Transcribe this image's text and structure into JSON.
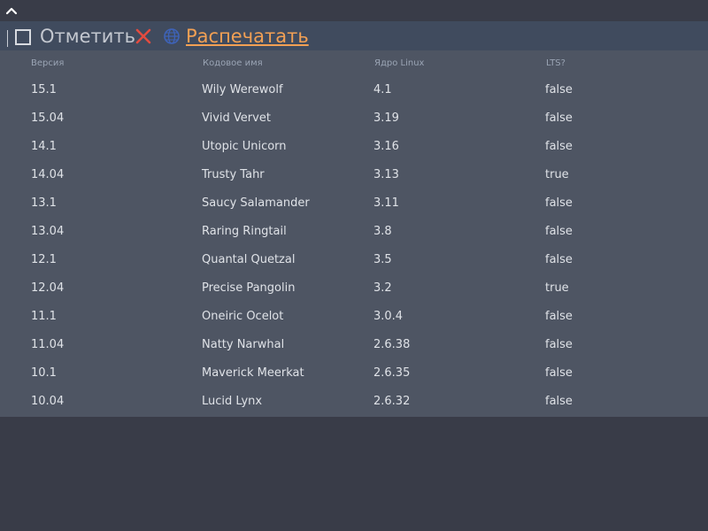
{
  "toolbar": {
    "mark_label": "Отметить",
    "print_label": "Распечатать"
  },
  "icons": {
    "collapse": "chevron-up-icon",
    "checkbox": "checkbox-icon",
    "clear": "close-icon",
    "print": "globe-icon"
  },
  "colors": {
    "page_bg": "#393c48",
    "toolbar_bg": "#404b5e",
    "grid_bg": "#4e5563",
    "clear_red": "#e34b3f",
    "print_orange": "#f2a054",
    "globe_blue": "#3e63b8"
  },
  "table": {
    "columns": [
      "Версия",
      "Кодовое имя",
      "Ядро Linux",
      "LTS?"
    ],
    "rows": [
      [
        "15.1",
        "Wily Werewolf",
        "4.1",
        "false"
      ],
      [
        "15.04",
        "Vivid Vervet",
        "3.19",
        "false"
      ],
      [
        "14.1",
        "Utopic Unicorn",
        "3.16",
        "false"
      ],
      [
        "14.04",
        "Trusty Tahr",
        "3.13",
        "true"
      ],
      [
        "13.1",
        "Saucy Salamander",
        "3.11",
        "false"
      ],
      [
        "13.04",
        "Raring Ringtail",
        "3.8",
        "false"
      ],
      [
        "12.1",
        "Quantal Quetzal",
        "3.5",
        "false"
      ],
      [
        "12.04",
        "Precise Pangolin",
        "3.2",
        "true"
      ],
      [
        "11.1",
        "Oneiric Ocelot",
        "3.0.4",
        "false"
      ],
      [
        "11.04",
        "Natty Narwhal",
        "2.6.38",
        "false"
      ],
      [
        "10.1",
        "Maverick Meerkat",
        "2.6.35",
        "false"
      ],
      [
        "10.04",
        "Lucid Lynx",
        "2.6.32",
        "false"
      ]
    ]
  }
}
